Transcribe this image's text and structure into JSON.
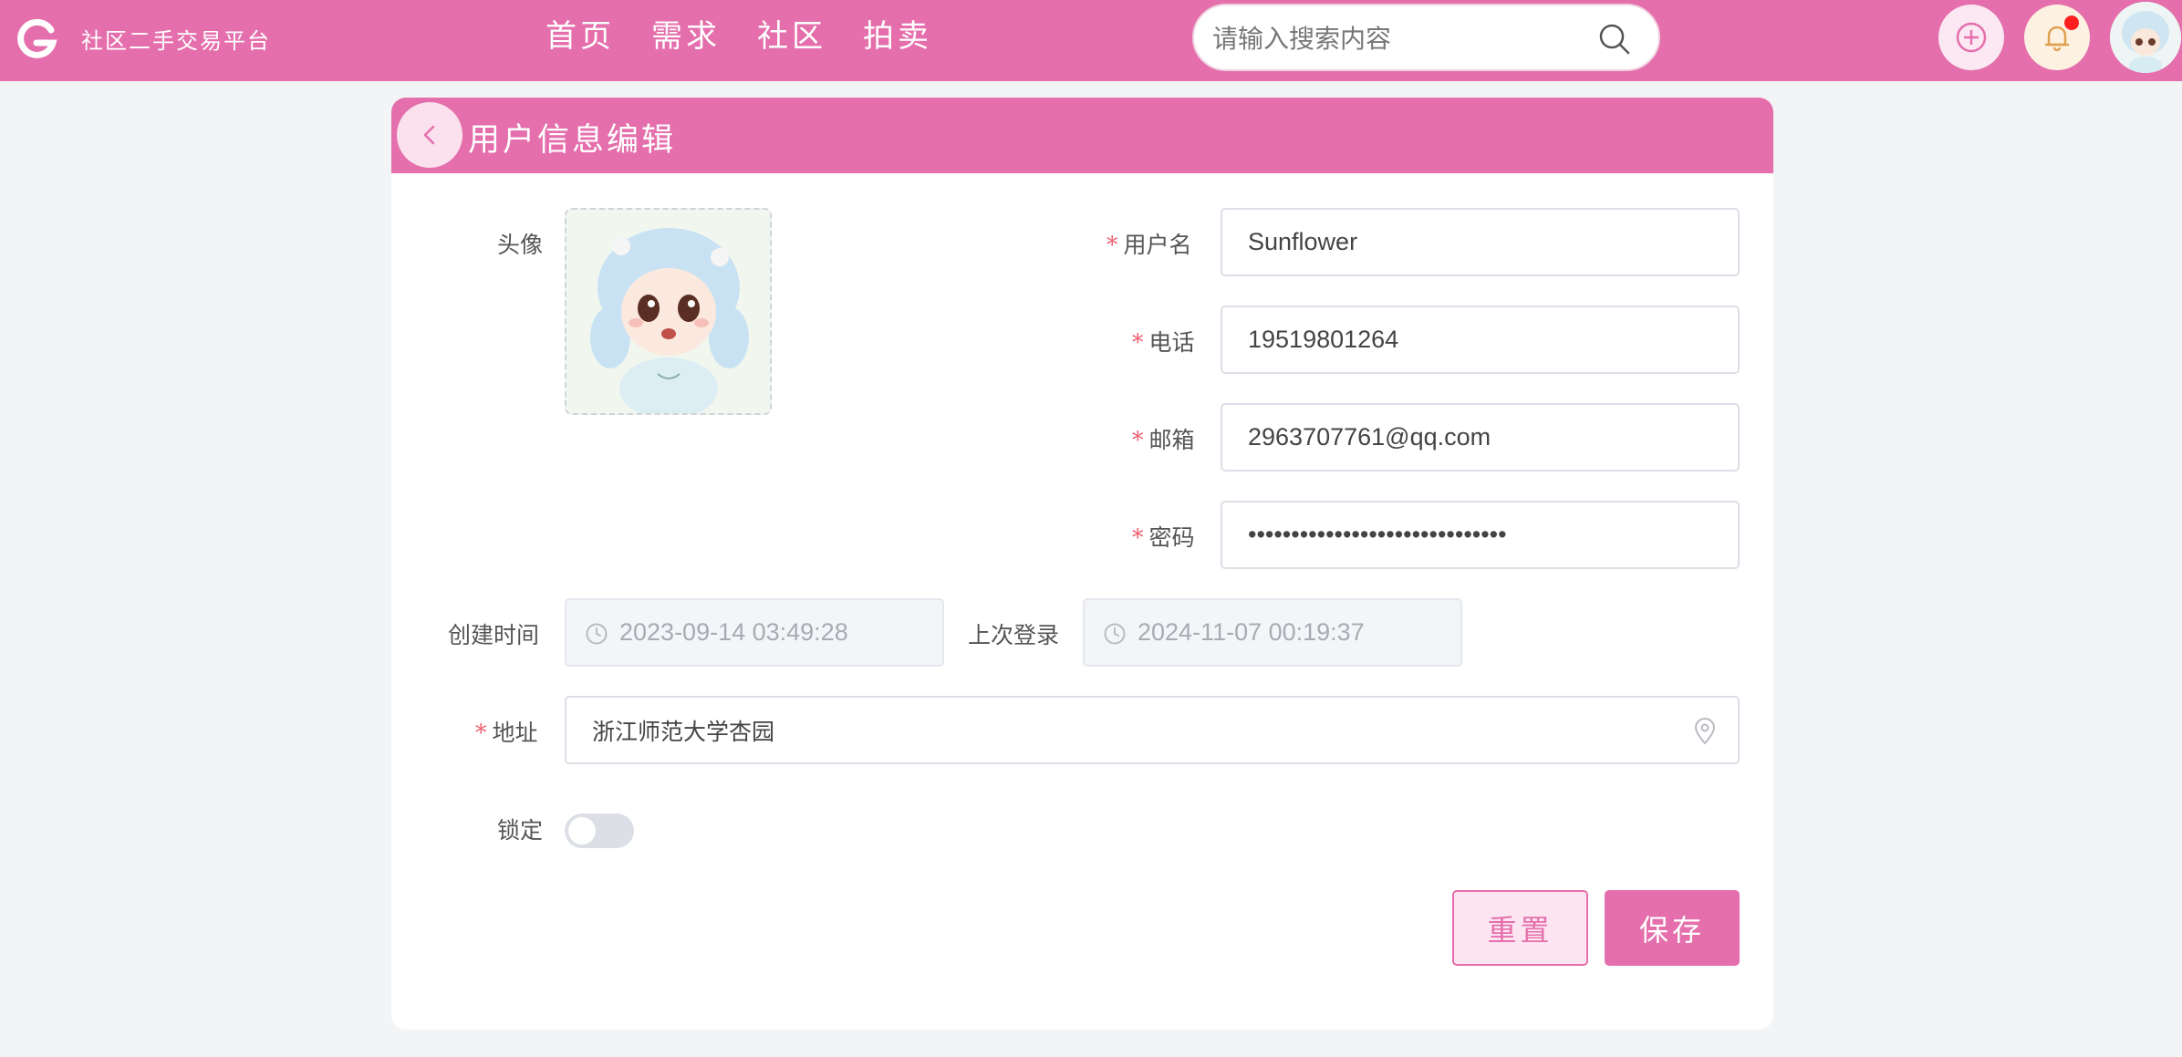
{
  "header": {
    "app_title": "社区二手交易平台",
    "nav": [
      "首页",
      "需求",
      "社区",
      "拍卖"
    ],
    "search": {
      "placeholder": "请输入搜索内容",
      "value": ""
    },
    "has_notification": true
  },
  "card": {
    "title": "用户信息编辑",
    "labels": {
      "avatar": "头像",
      "username": "用户名",
      "phone": "电话",
      "email": "邮箱",
      "password": "密码",
      "created_at": "创建时间",
      "last_login": "上次登录",
      "address": "地址",
      "locked": "锁定"
    },
    "values": {
      "username": "Sunflower",
      "phone": "19519801264",
      "email": "2963707761@qq.com",
      "password": "••••••••••••••••••••••••••••••",
      "created_at": "2023-09-14 03:49:28",
      "last_login": "2024-11-07 00:19:37",
      "address": "浙江师范大学杏园",
      "locked": false
    },
    "buttons": {
      "reset": "重置",
      "save": "保存"
    }
  },
  "colors": {
    "accent": "#e46fac",
    "required": "#f06070"
  }
}
